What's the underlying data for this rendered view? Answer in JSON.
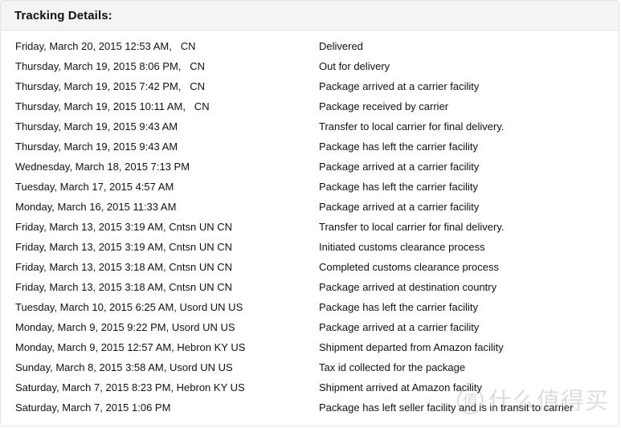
{
  "panel": {
    "title": "Tracking Details:"
  },
  "events": [
    {
      "date": "Friday, March 20, 2015 12:53 AM,   CN",
      "status": "Delivered"
    },
    {
      "date": "Thursday, March 19, 2015 8:06 PM,   CN",
      "status": "Out for delivery"
    },
    {
      "date": "Thursday, March 19, 2015 7:42 PM,   CN",
      "status": "Package arrived at a carrier facility"
    },
    {
      "date": "Thursday, March 19, 2015 10:11 AM,   CN",
      "status": "Package received by carrier"
    },
    {
      "date": "Thursday, March 19, 2015 9:43 AM",
      "status": "Transfer to local carrier for final delivery."
    },
    {
      "date": "Thursday, March 19, 2015 9:43 AM",
      "status": "Package has left the carrier facility"
    },
    {
      "date": "Wednesday, March 18, 2015 7:13 PM",
      "status": "Package arrived at a carrier facility"
    },
    {
      "date": "Tuesday, March 17, 2015 4:57 AM",
      "status": "Package has left the carrier facility"
    },
    {
      "date": "Monday, March 16, 2015 11:33 AM",
      "status": "Package arrived at a carrier facility"
    },
    {
      "date": "Friday, March 13, 2015 3:19 AM, Cntsn UN CN",
      "status": "Transfer to local carrier for final delivery."
    },
    {
      "date": "Friday, March 13, 2015 3:19 AM, Cntsn UN CN",
      "status": "Initiated customs clearance process"
    },
    {
      "date": "Friday, March 13, 2015 3:18 AM, Cntsn UN CN",
      "status": "Completed customs clearance process"
    },
    {
      "date": "Friday, March 13, 2015 3:18 AM, Cntsn UN CN",
      "status": "Package arrived at destination country"
    },
    {
      "date": "Tuesday, March 10, 2015 6:25 AM, Usord UN US",
      "status": "Package has left the carrier facility"
    },
    {
      "date": "Monday, March 9, 2015 9:22 PM, Usord UN US",
      "status": "Package arrived at a carrier facility"
    },
    {
      "date": "Monday, March 9, 2015 12:57 AM, Hebron KY US",
      "status": "Shipment departed from Amazon facility"
    },
    {
      "date": "Sunday, March 8, 2015 3:58 AM, Usord UN US",
      "status": "Tax id collected for the package"
    },
    {
      "date": "Saturday, March 7, 2015 8:23 PM, Hebron KY US",
      "status": "Shipment arrived at Amazon facility"
    },
    {
      "date": "Saturday, March 7, 2015 1:06 PM",
      "status": "Package has left seller facility and is in transit to carrier"
    }
  ],
  "watermark": {
    "logo_char": "值",
    "text": "什么值得买"
  },
  "colors": {
    "header_bg": "#f4f4f4",
    "border": "#e3e3e3",
    "text": "#111111",
    "watermark": "#8d8d8d"
  }
}
